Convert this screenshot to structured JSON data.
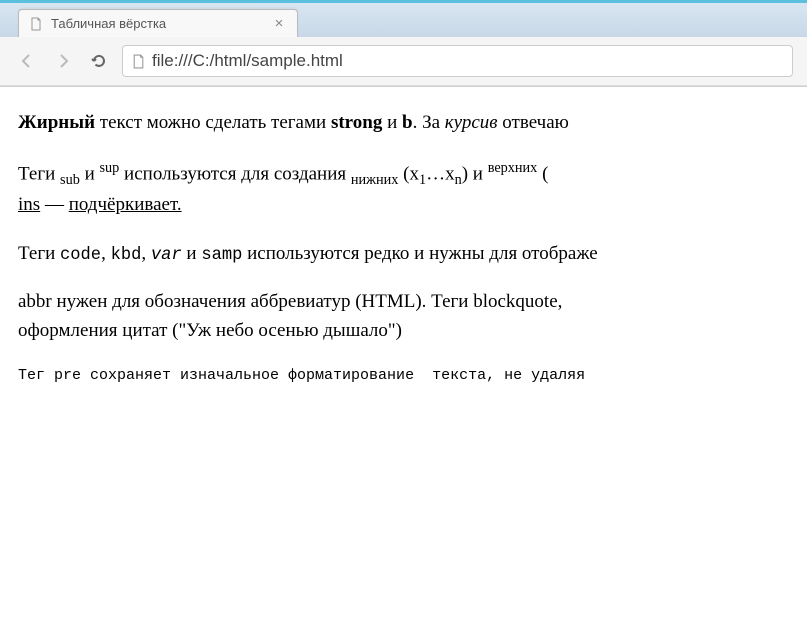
{
  "tab": {
    "title": "Табличная вёрстка"
  },
  "address": {
    "url": "file:///C:/html/sample.html"
  },
  "content": {
    "p1": {
      "bold1": "Жирный",
      "t1": " текст можно сделать тегами ",
      "bold2": "strong",
      "t2": " и ",
      "bold3": "b",
      "t3": ". За ",
      "italic1": "курсив",
      "t4": " отвечаю"
    },
    "p2a": {
      "t1": "Теги ",
      "sub1": "sub",
      "t2": " и ",
      "sup1": "sup",
      "t3": " используются для создания ",
      "sub2": "нижних",
      "t4": " (x",
      "sub3": "1",
      "t5": "…x",
      "sub4": "n",
      "t6": ") и ",
      "sup2": "верхних",
      "t7": " ("
    },
    "p2b": {
      "u1": "ins",
      "t1": " — ",
      "u2": "подчёркивает."
    },
    "p3": {
      "t1": "Теги ",
      "code1": "code",
      "t2": ", ",
      "code2": "kbd",
      "t3": ", ",
      "var1": "var",
      "t4": " и ",
      "code3": "samp",
      "t5": " используются редко и нужны для отображе"
    },
    "p4": {
      "t1": "abbr нужен для обозначения аббревиатур (HTML). Теги blockquote,",
      "t2": "оформления цитат (\"Уж небо осенью дышало\")"
    },
    "pre": "Тег pre сохраняет изначальное форматирование  текста, не удаляя "
  }
}
